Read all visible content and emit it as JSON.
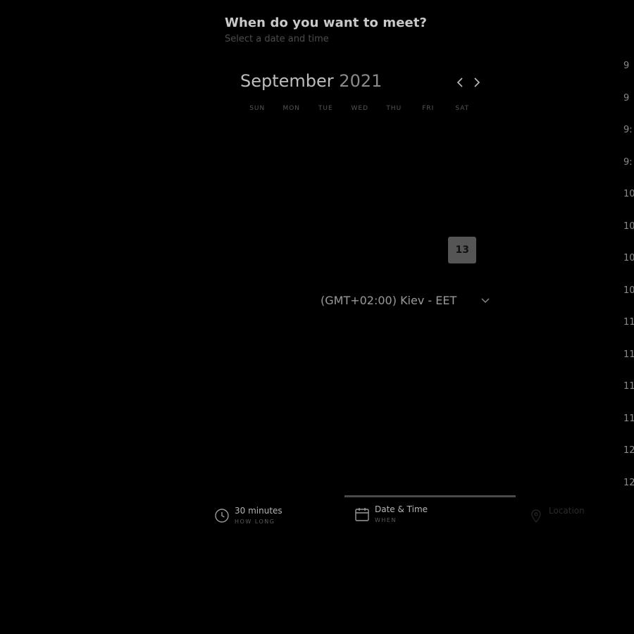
{
  "header": {
    "title": "When do you want to meet?",
    "subtitle": "Select a date and time"
  },
  "calendar": {
    "month": "September",
    "year": "2021",
    "weekdays": [
      "SUN",
      "MON",
      "TUE",
      "WED",
      "THU",
      "FRI",
      "SAT"
    ],
    "weeks": [
      [
        "",
        "",
        "",
        "",
        "",
        "",
        ""
      ],
      [
        "",
        "",
        "",
        "",
        "",
        "",
        ""
      ],
      [
        "",
        "",
        "",
        "",
        "",
        "",
        ""
      ],
      [
        "",
        "",
        "",
        "",
        "",
        "",
        ""
      ],
      [
        "",
        "",
        "",
        "",
        "",
        "",
        "13"
      ]
    ],
    "selected_day": "13"
  },
  "timezone": {
    "label": "(GMT+02:00) Kiev - EET"
  },
  "time_slots": [
    "9",
    "9",
    "9:",
    "9:",
    "10",
    "10",
    "10",
    "10",
    "11",
    "11",
    "11",
    "11",
    "12",
    "12"
  ],
  "steps": [
    {
      "value": "30 minutes",
      "caption": "HOW LONG",
      "icon": "clock-icon"
    },
    {
      "value": "Date & Time",
      "caption": "WHEN",
      "icon": "calendar-icon",
      "active": true
    },
    {
      "value": "Location",
      "caption": "",
      "icon": "location-icon"
    }
  ]
}
